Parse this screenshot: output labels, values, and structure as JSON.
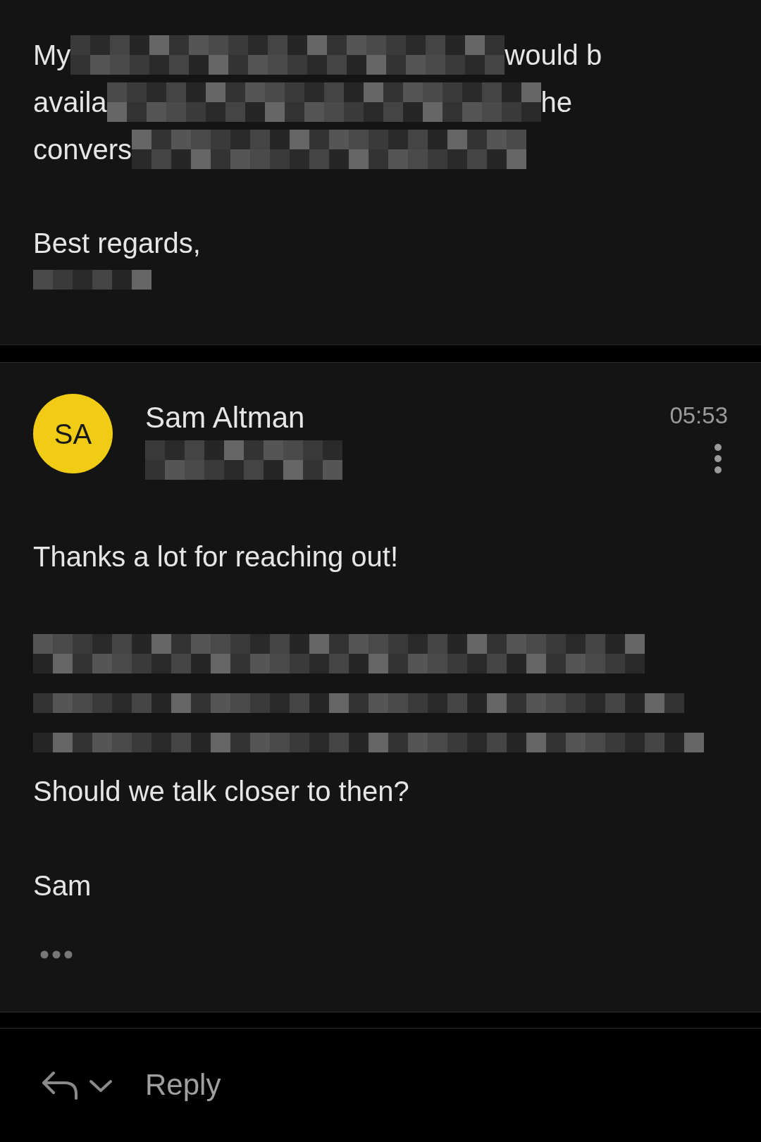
{
  "previous_message": {
    "lines": [
      {
        "fragments": [
          "My",
          "would b"
        ]
      },
      {
        "fragments": [
          "availa",
          "he"
        ]
      },
      {
        "fragments": [
          "convers"
        ]
      }
    ],
    "closing": "Best regards,"
  },
  "message": {
    "initials": "SA",
    "sender": "Sam Altman",
    "time": "05:53",
    "greeting": "Thanks a lot for reaching out!",
    "question": "Should we talk closer to then?",
    "signature": "Sam"
  },
  "reply_bar": {
    "label": "Reply"
  }
}
